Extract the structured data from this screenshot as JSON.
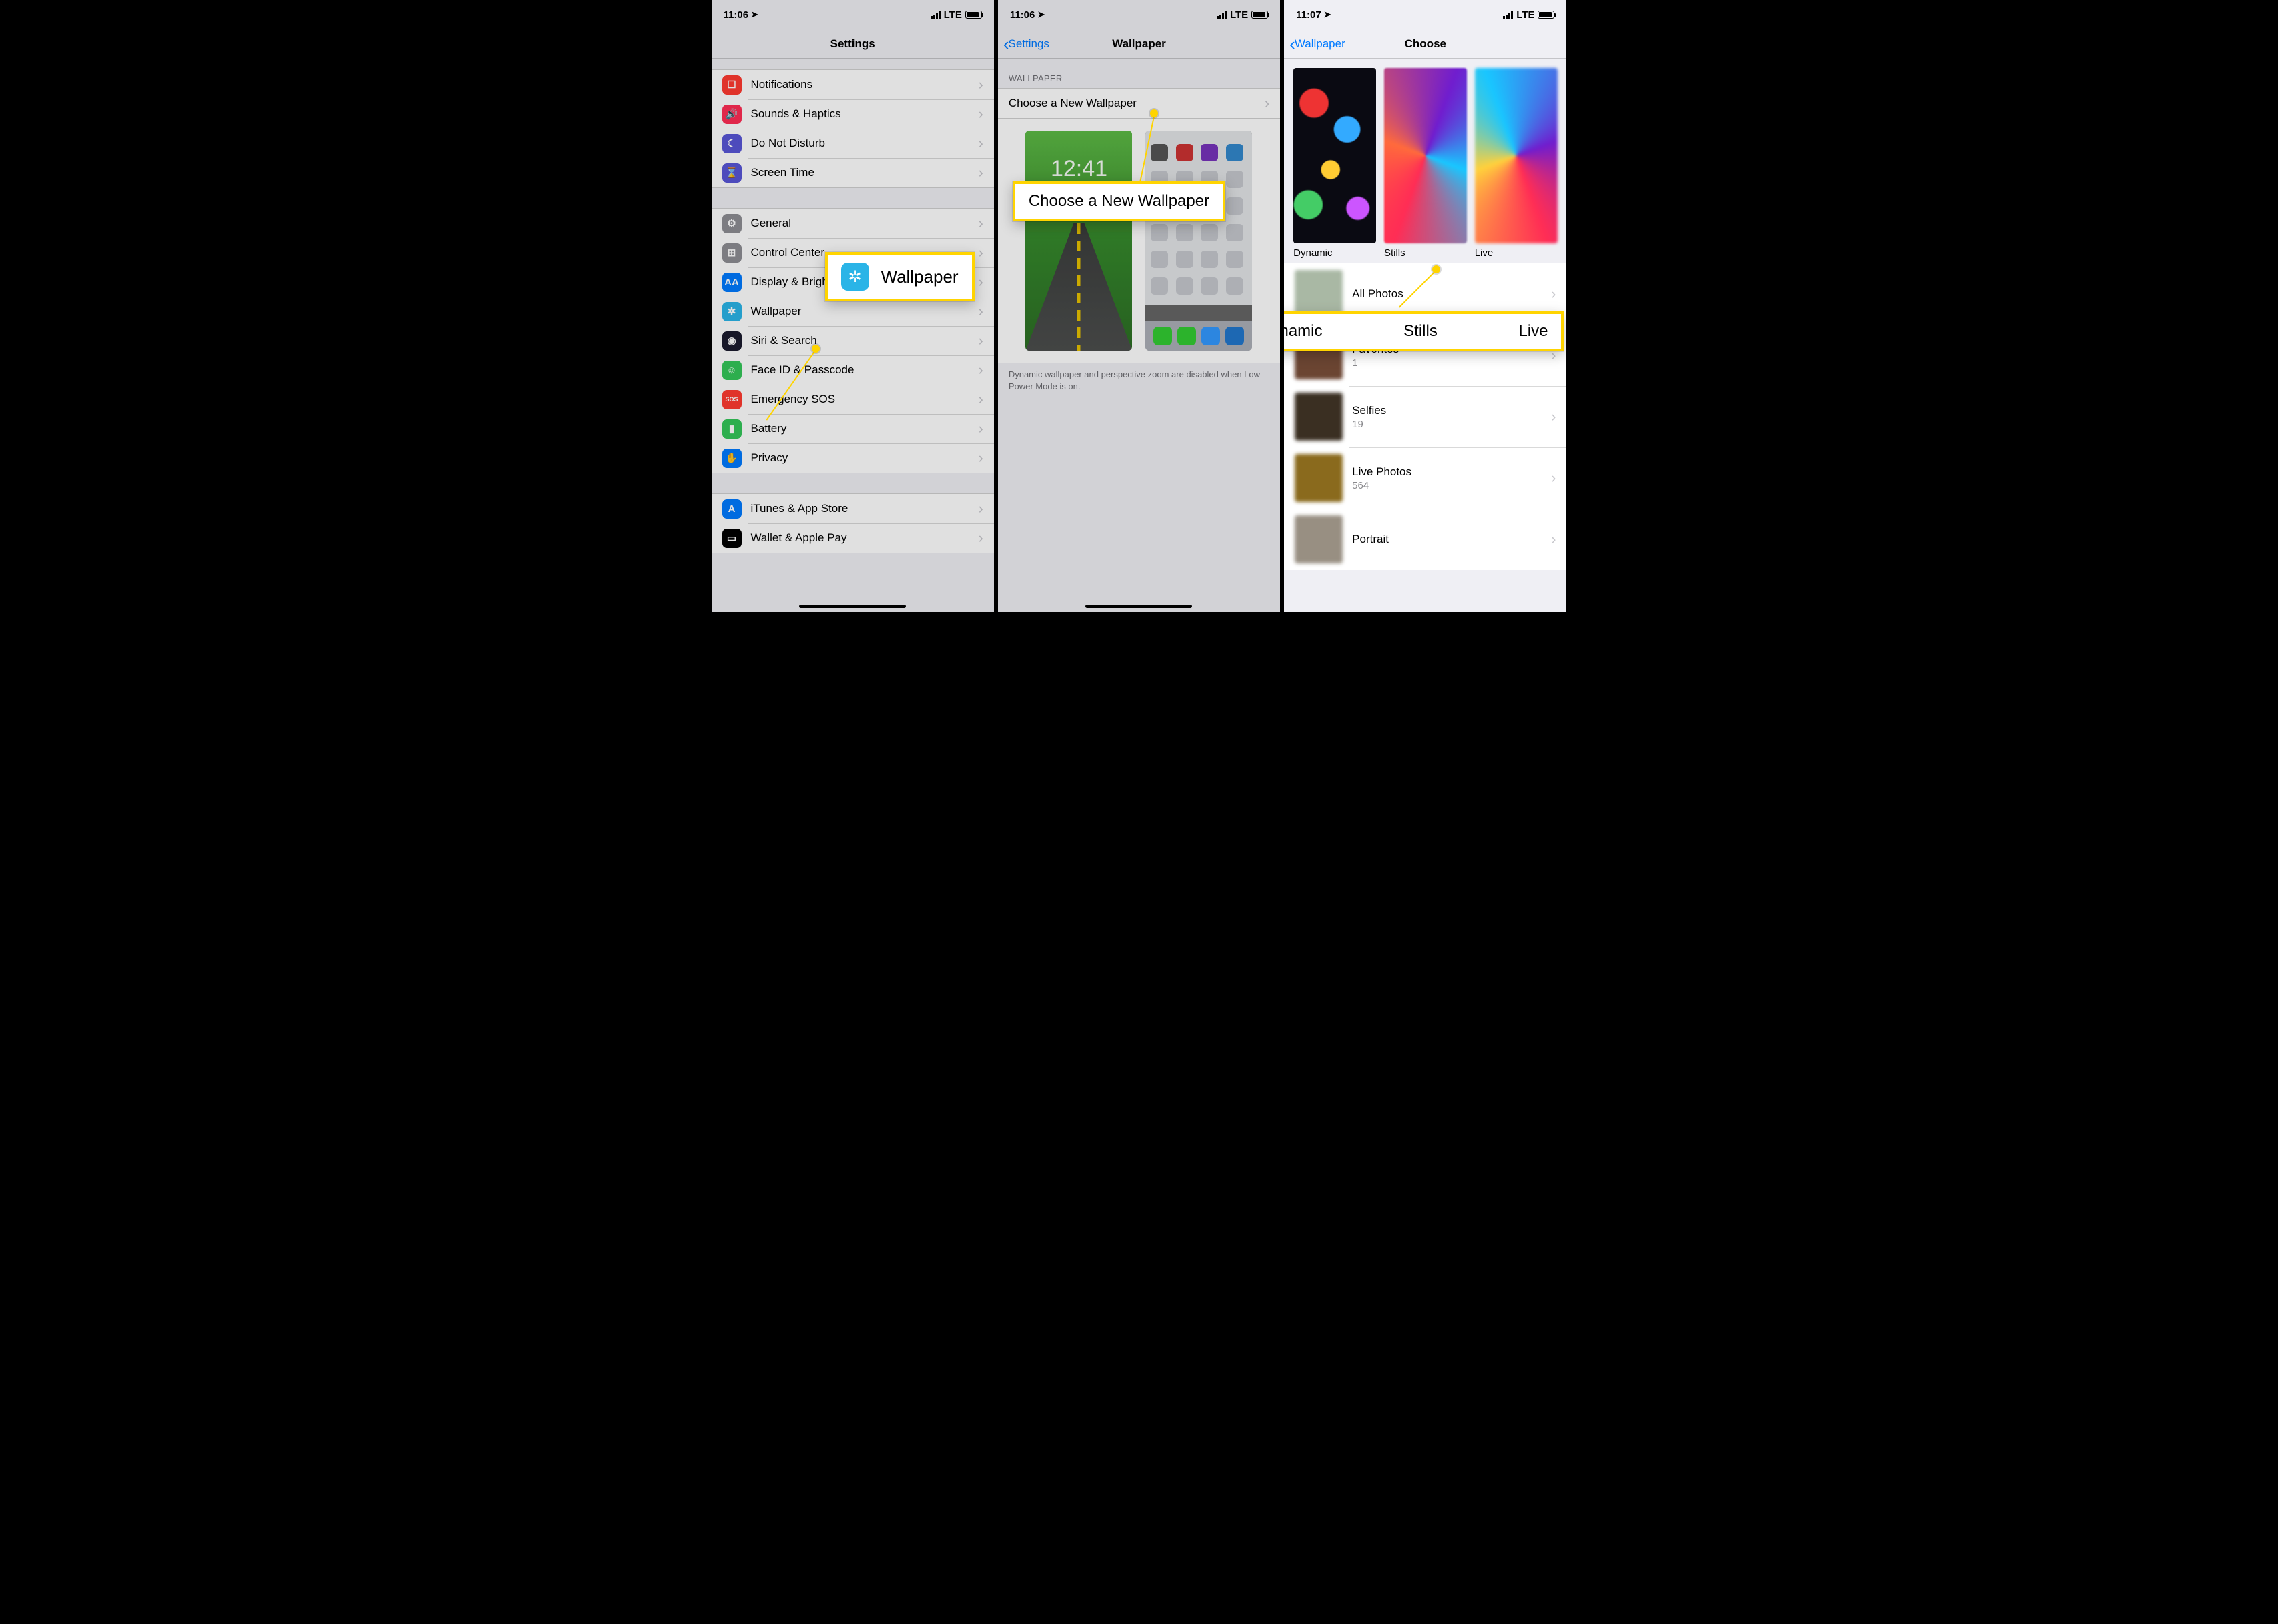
{
  "status": {
    "time1": "11:06",
    "time2": "11:06",
    "time3": "11:07",
    "net": "LTE"
  },
  "panel1": {
    "title": "Settings",
    "group1": [
      {
        "label": "Notifications",
        "icon_bg": "#ff3b30",
        "icon": "notifications-icon",
        "glyph": "☐"
      },
      {
        "label": "Sounds & Haptics",
        "icon_bg": "#ff2d55",
        "icon": "sounds-icon",
        "glyph": "🔊"
      },
      {
        "label": "Do Not Disturb",
        "icon_bg": "#5856d6",
        "icon": "dnd-icon",
        "glyph": "☾"
      },
      {
        "label": "Screen Time",
        "icon_bg": "#5856d6",
        "icon": "screentime-icon",
        "glyph": "⌛"
      }
    ],
    "group2": [
      {
        "label": "General",
        "icon_bg": "#8e8e93",
        "icon": "general-icon",
        "glyph": "⚙"
      },
      {
        "label": "Control Center",
        "icon_bg": "#8e8e93",
        "icon": "control-center-icon",
        "glyph": "⊞"
      },
      {
        "label": "Display & Brightness",
        "icon_bg": "#007aff",
        "icon": "display-icon",
        "glyph": "AA"
      },
      {
        "label": "Wallpaper",
        "icon_bg": "#2ab4e7",
        "icon": "wallpaper-icon",
        "glyph": "✲"
      },
      {
        "label": "Siri & Search",
        "icon_bg": "#1b1b2e",
        "icon": "siri-icon",
        "glyph": "◉"
      },
      {
        "label": "Face ID & Passcode",
        "icon_bg": "#34c759",
        "icon": "faceid-icon",
        "glyph": "☺"
      },
      {
        "label": "Emergency SOS",
        "icon_bg": "#ff3b30",
        "icon": "sos-icon",
        "glyph": "SOS"
      },
      {
        "label": "Battery",
        "icon_bg": "#34c759",
        "icon": "battery-icon",
        "glyph": "▮"
      },
      {
        "label": "Privacy",
        "icon_bg": "#007aff",
        "icon": "privacy-icon",
        "glyph": "✋"
      }
    ],
    "group3": [
      {
        "label": "iTunes & App Store",
        "icon_bg": "#007aff",
        "icon": "appstore-icon",
        "glyph": "A"
      },
      {
        "label": "Wallet & Apple Pay",
        "icon_bg": "#000",
        "icon": "wallet-icon",
        "glyph": "▭"
      }
    ]
  },
  "panel2": {
    "back": "Settings",
    "title": "Wallpaper",
    "section_header": "WALLPAPER",
    "choose": "Choose a New Wallpaper",
    "lock_time": "12:41",
    "footer": "Dynamic wallpaper and perspective zoom are disabled when Low Power Mode is on."
  },
  "panel3": {
    "back": "Wallpaper",
    "title": "Choose",
    "cats": [
      {
        "label": "Dynamic"
      },
      {
        "label": "Stills"
      },
      {
        "label": "Live"
      }
    ],
    "albums": [
      {
        "name": "All Photos",
        "count": "",
        "thumb_bg": "#a9b8a4"
      },
      {
        "name": "Favorites",
        "count": "1",
        "thumb_bg": "#6b4532"
      },
      {
        "name": "Selfies",
        "count": "19",
        "thumb_bg": "#3a2f22"
      },
      {
        "name": "Live Photos",
        "count": "564",
        "thumb_bg": "#8a6a1d"
      },
      {
        "name": "Portrait",
        "count": "",
        "thumb_bg": "#988f82"
      }
    ]
  },
  "callouts": {
    "c1": "Wallpaper",
    "c2": "Choose a New Wallpaper",
    "c3": {
      "a": "Dynamic",
      "b": "Stills",
      "c": "Live"
    }
  }
}
